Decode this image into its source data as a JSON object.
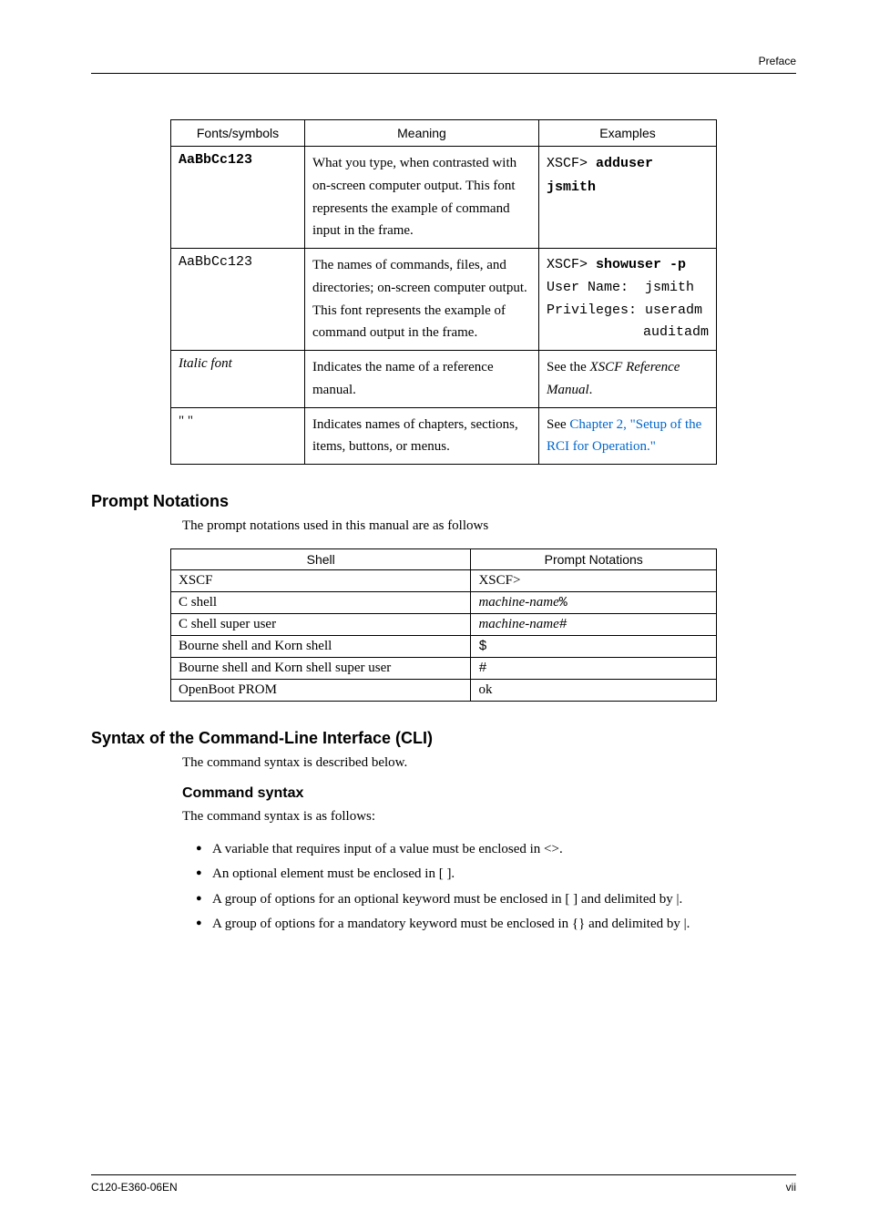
{
  "header": {
    "preface": "Preface"
  },
  "table1": {
    "headers": {
      "fonts": "Fonts/symbols",
      "meaning": "Meaning",
      "examples": "Examples"
    },
    "row1": {
      "font": "AaBbCc123",
      "meaning": "What you type, when contrasted with on-screen computer output.\nThis font represents the example of command input in the frame.",
      "ex_prefix": "XSCF> ",
      "ex_bold": "adduser jsmith"
    },
    "row2": {
      "font": "AaBbCc123",
      "meaning": "The names of commands, files, and directories; on-screen computer output.\nThis font represents the example of command output in the frame.",
      "ex_l1_left": "XSCF> ",
      "ex_l1_bold": "showuser -p",
      "ex_l2_left": "User Name:",
      "ex_l2_right": "jsmith",
      "ex_l3_left": "Privileges:",
      "ex_l3_right": "useradm",
      "ex_l4_right": "auditadm"
    },
    "row3": {
      "font": "Italic font",
      "meaning": "Indicates the name of a reference manual.",
      "ex_pre": "See the ",
      "ex_italic": "XSCF Reference Manual",
      "ex_post": "."
    },
    "row4": {
      "font": "\" \"",
      "meaning": "Indicates names of chapters, sections, items, buttons, or menus.",
      "ex_pre": "See ",
      "ex_link": "Chapter 2, \"Setup of the RCI for Operation.\""
    }
  },
  "prompt": {
    "title": "Prompt Notations",
    "intro": "The prompt notations used in this manual are as follows",
    "headers": {
      "shell": "Shell",
      "prompt": "Prompt Notations"
    },
    "rows": [
      {
        "shell": "XSCF",
        "prompt": "XSCF>",
        "italic": false,
        "suffix": ""
      },
      {
        "shell": "C shell",
        "prompt": "machine-name",
        "italic": true,
        "suffix": "%"
      },
      {
        "shell": "C shell super user",
        "prompt": "machine-name",
        "italic": true,
        "suffix": "#"
      },
      {
        "shell": "Bourne shell and Korn shell",
        "prompt": "$",
        "italic": false,
        "suffix": "",
        "mono": true
      },
      {
        "shell": "Bourne shell and Korn shell super user",
        "prompt": "#",
        "italic": false,
        "suffix": "",
        "mono": true
      },
      {
        "shell": "OpenBoot PROM",
        "prompt": "ok",
        "italic": false,
        "suffix": ""
      }
    ]
  },
  "cli": {
    "title": "Syntax of the Command-Line Interface (CLI)",
    "intro": "The command syntax is described below.",
    "sub": "Command syntax",
    "subintro": "The command syntax is as follows:",
    "bullets": [
      "A variable that requires input of a value must be enclosed in <>.",
      "An optional element must be enclosed in [ ].",
      "A group of options for an optional keyword must be enclosed in [ ] and delimited by |.",
      "A group of options for a mandatory keyword must be enclosed in {} and delimited by |."
    ]
  },
  "footer": {
    "left": "C120-E360-06EN",
    "right": "vii"
  }
}
